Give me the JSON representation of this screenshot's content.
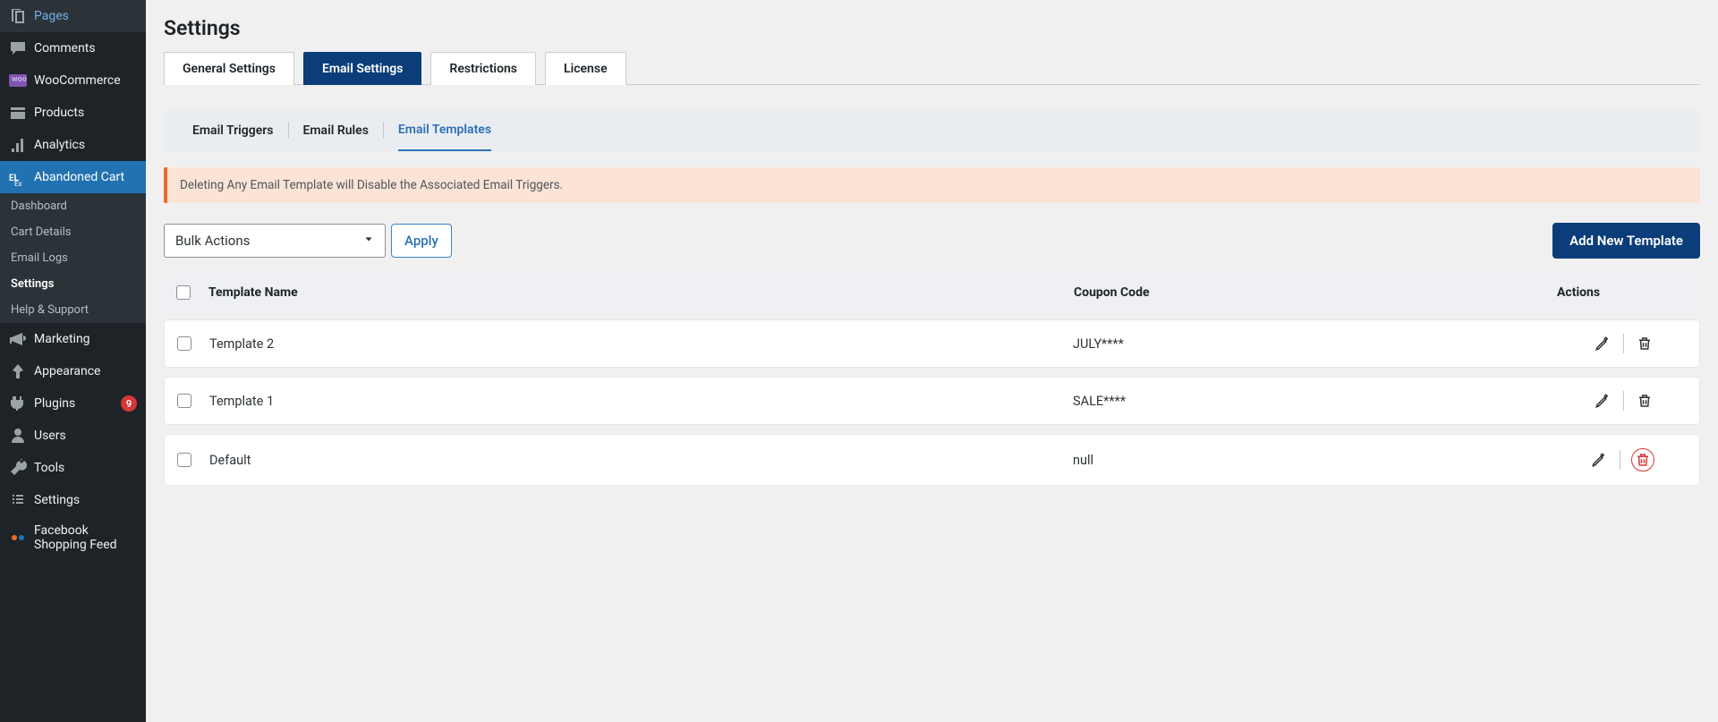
{
  "sidebar": {
    "nav": [
      {
        "key": "pages",
        "label": "Pages"
      },
      {
        "key": "comments",
        "label": "Comments"
      },
      {
        "key": "woocommerce",
        "label": "WooCommerce"
      },
      {
        "key": "products",
        "label": "Products"
      },
      {
        "key": "analytics",
        "label": "Analytics"
      },
      {
        "key": "abandoned-cart",
        "label": "Abandoned Cart",
        "active": true
      },
      {
        "key": "marketing",
        "label": "Marketing"
      },
      {
        "key": "appearance",
        "label": "Appearance"
      },
      {
        "key": "plugins",
        "label": "Plugins",
        "badge": "9"
      },
      {
        "key": "users",
        "label": "Users"
      },
      {
        "key": "tools",
        "label": "Tools"
      },
      {
        "key": "settings",
        "label": "Settings"
      },
      {
        "key": "facebook-feed",
        "label": "Facebook Shopping Feed"
      }
    ],
    "submenu": [
      {
        "label": "Dashboard"
      },
      {
        "label": "Cart Details"
      },
      {
        "label": "Email Logs"
      },
      {
        "label": "Settings",
        "current": true
      },
      {
        "label": "Help & Support"
      }
    ]
  },
  "page": {
    "title": "Settings",
    "tabs": [
      {
        "label": "General Settings"
      },
      {
        "label": "Email Settings",
        "active": true
      },
      {
        "label": "Restrictions"
      },
      {
        "label": "License"
      }
    ],
    "subtabs": [
      {
        "label": "Email Triggers"
      },
      {
        "label": "Email Rules"
      },
      {
        "label": "Email Templates",
        "active": true
      }
    ],
    "alert": "Deleting Any Email Template will Disable the Associated Email Triggers.",
    "bulk": {
      "placeholder": "Bulk Actions",
      "apply": "Apply"
    },
    "add_button": "Add New Template",
    "columns": {
      "name": "Template Name",
      "coupon": "Coupon Code",
      "actions": "Actions"
    },
    "rows": [
      {
        "name": "Template 2",
        "coupon": "JULY****"
      },
      {
        "name": "Template 1",
        "coupon": "SALE****"
      },
      {
        "name": "Default",
        "coupon": "null",
        "del_hover": true
      }
    ]
  }
}
